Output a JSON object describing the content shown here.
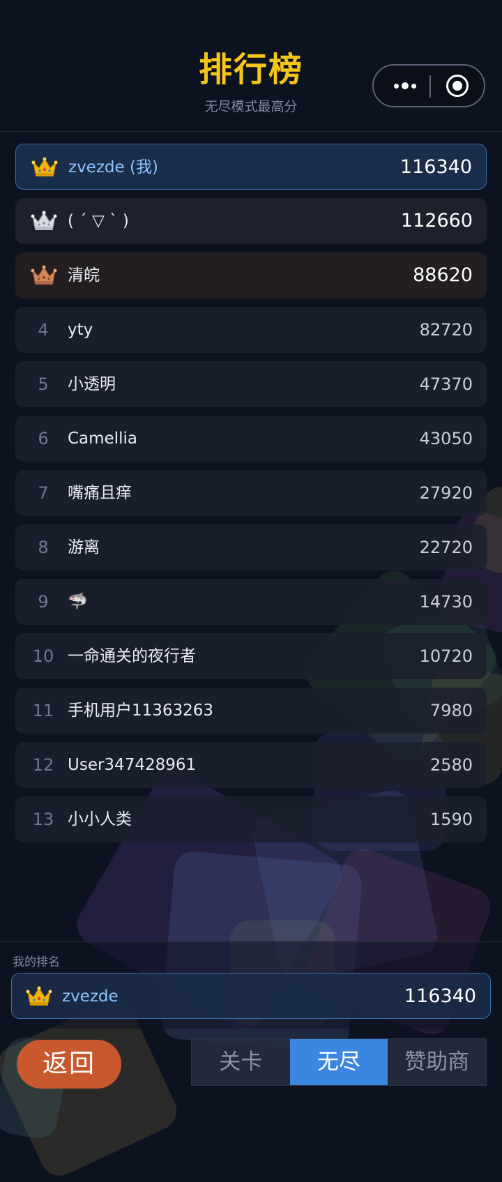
{
  "header": {
    "title": "排行榜",
    "subtitle": "无尽模式最高分",
    "capsule": {
      "more_icon": "more-dots-icon",
      "close_icon": "target-circle-icon"
    }
  },
  "colors": {
    "title_gold": "#f5c518",
    "accent_blue": "#3a86e0",
    "back_orange": "#c8582e",
    "me_highlight": "#8fc3ff"
  },
  "leaderboard": {
    "entries": [
      {
        "rank": "1",
        "name": "zvezde (我)",
        "score": "116340",
        "icon": "gold-crown-icon"
      },
      {
        "rank": "2",
        "name": "( ´ ▽ ` )",
        "score": "112660",
        "icon": "silver-crown-icon"
      },
      {
        "rank": "3",
        "name": "清皖",
        "score": "88620",
        "icon": "bronze-crown-icon"
      },
      {
        "rank": "4",
        "name": "yty",
        "score": "82720"
      },
      {
        "rank": "5",
        "name": "小透明",
        "score": "47370"
      },
      {
        "rank": "6",
        "name": "Camellia",
        "score": "43050"
      },
      {
        "rank": "7",
        "name": "嘴痛且痒",
        "score": "27920"
      },
      {
        "rank": "8",
        "name": "游离",
        "score": "22720"
      },
      {
        "rank": "9",
        "name": "🦈",
        "score": "14730"
      },
      {
        "rank": "10",
        "name": "一命通关的夜行者",
        "score": "10720"
      },
      {
        "rank": "11",
        "name": "手机用户11363263",
        "score": "7980"
      },
      {
        "rank": "12",
        "name": "User347428961",
        "score": "2580"
      },
      {
        "rank": "13",
        "name": "小小人类",
        "score": "1590"
      }
    ]
  },
  "my_rank": {
    "label": "我的排名",
    "name": "zvezde",
    "score": "116340",
    "icon": "gold-crown-icon"
  },
  "bottom": {
    "back_label": "返回",
    "tabs": [
      {
        "label": "关卡",
        "active": false
      },
      {
        "label": "无尽",
        "active": true
      },
      {
        "label": "赞助商",
        "active": false
      }
    ]
  }
}
